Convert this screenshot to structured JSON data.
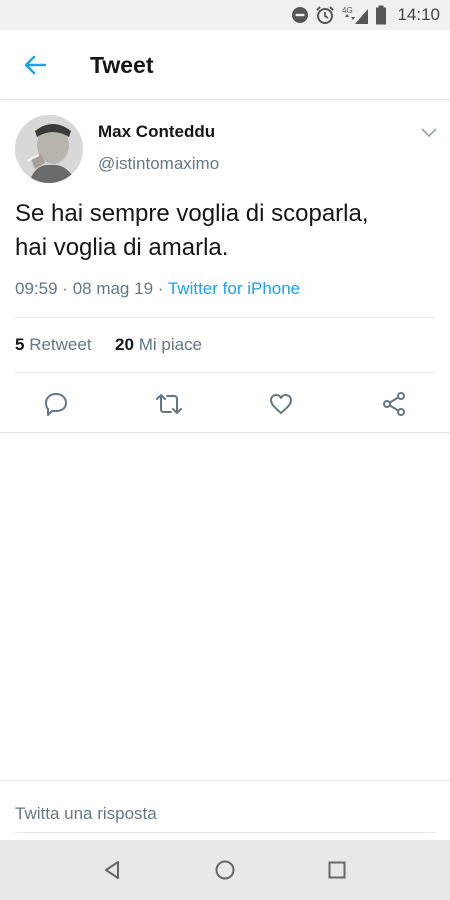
{
  "status_bar": {
    "time": "14:10",
    "network_label": "4G",
    "icons": [
      "do-not-disturb-icon",
      "alarm-icon",
      "signal-icon",
      "battery-icon"
    ]
  },
  "app_bar": {
    "title": "Tweet",
    "back_icon": "arrow-left-icon"
  },
  "tweet": {
    "author_name": "Max Conteddu",
    "author_handle": "@istintomaximo",
    "text_line1": "Se hai sempre voglia di scoparla,",
    "text_line2": "hai voglia di amarla.",
    "time": "09:59",
    "date": "08 mag 19",
    "separator": "·",
    "source": "Twitter for iPhone",
    "retweet_count": "5",
    "retweet_label": "Retweet",
    "like_count": "20",
    "like_label": "Mi piace",
    "actions": [
      "reply-icon",
      "retweet-icon",
      "like-icon",
      "share-icon"
    ]
  },
  "reply": {
    "placeholder": "Twitta una risposta"
  },
  "nav_bar": {
    "buttons": [
      "back-triangle-icon",
      "home-circle-icon",
      "recents-square-icon"
    ]
  },
  "colors": {
    "accent": "#1da1f2",
    "text_primary": "#14171a",
    "text_secondary": "#657786",
    "divider": "#e1e8ed",
    "status_bar_bg": "#f0f0f0",
    "nav_bar_bg": "#e8e8e8"
  }
}
